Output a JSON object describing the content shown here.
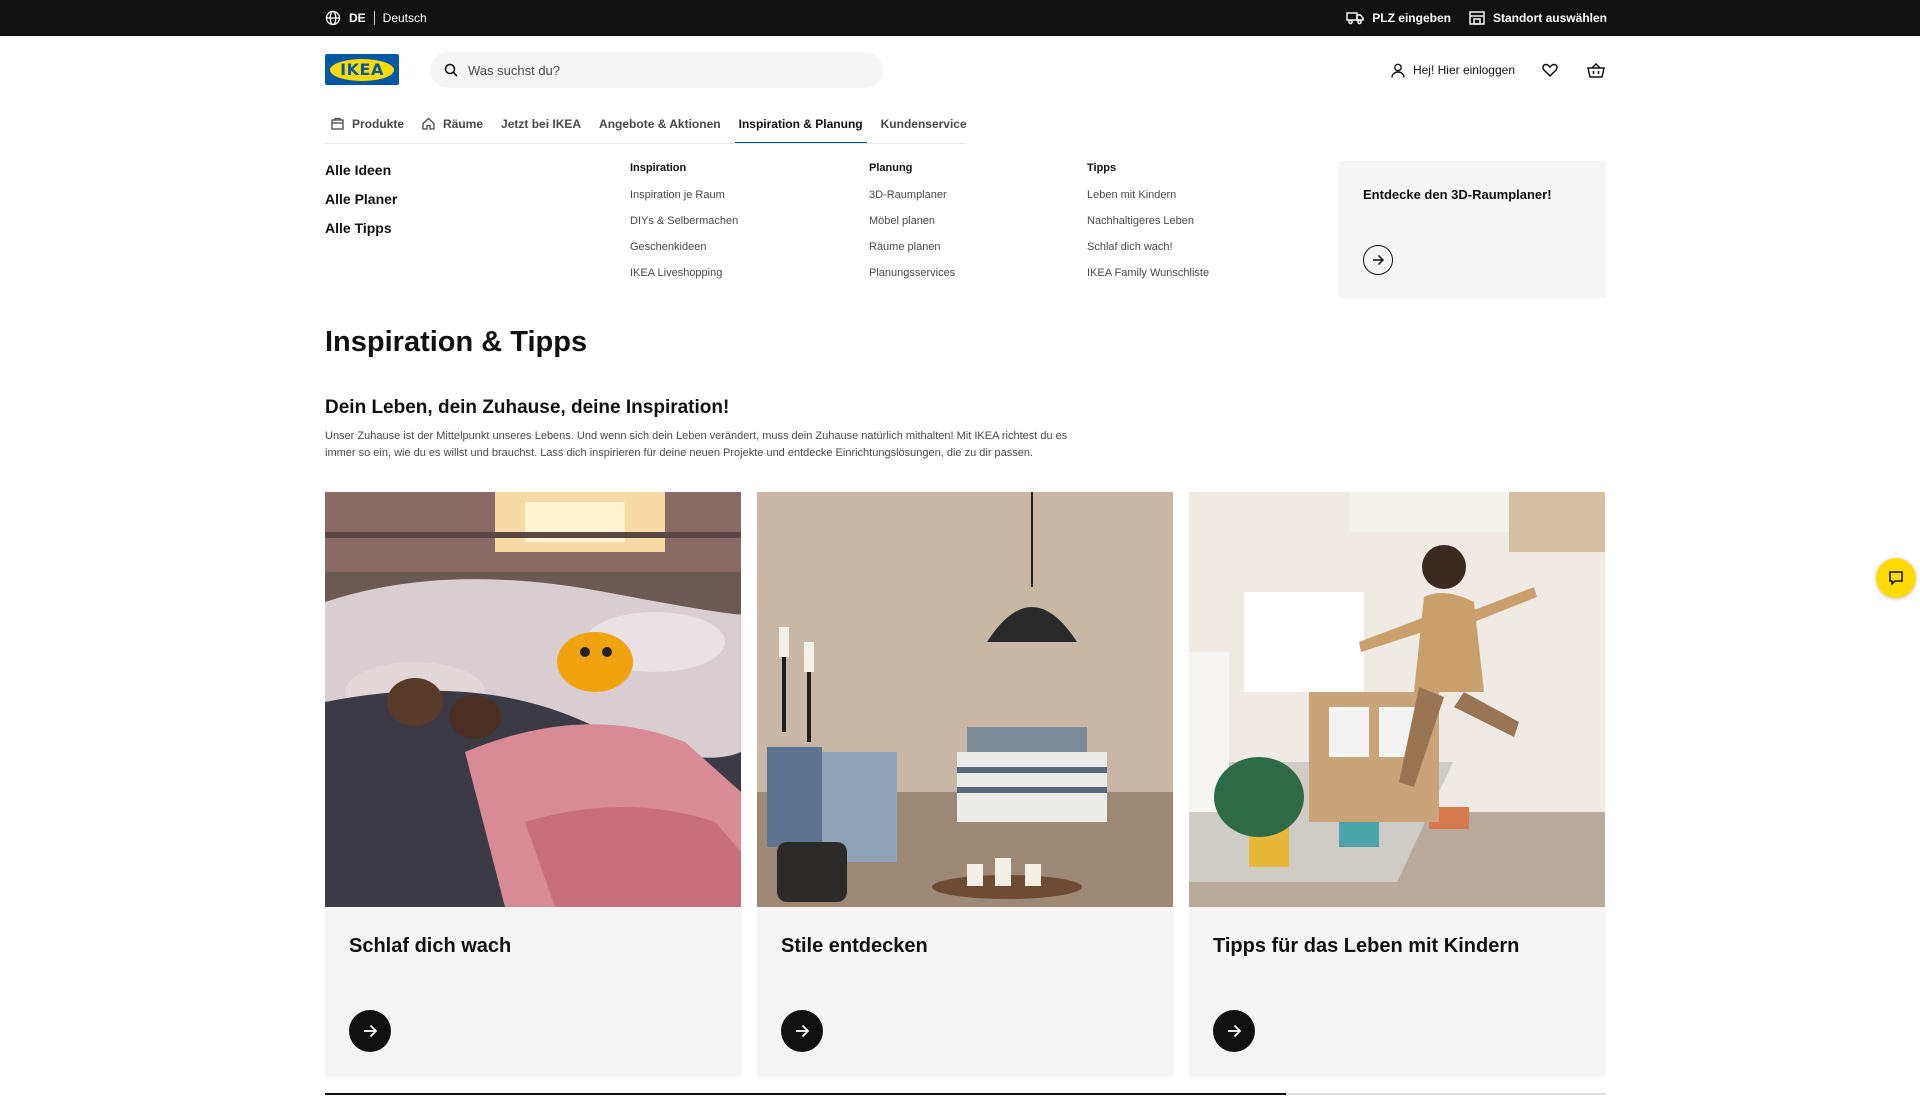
{
  "topbar": {
    "country": "DE",
    "language": "Deutsch",
    "zip_label": "PLZ eingeben",
    "store_label": "Standort auswählen"
  },
  "header": {
    "logo_text": "IKEA",
    "search_placeholder": "Was suchst du?",
    "login_label": "Hej! Hier einloggen"
  },
  "nav": {
    "tabs": [
      {
        "label": "Produkte",
        "icon": "bag-icon"
      },
      {
        "label": "Räume",
        "icon": "house-icon"
      },
      {
        "label": "Jetzt bei IKEA"
      },
      {
        "label": "Angebote & Aktionen"
      },
      {
        "label": "Inspiration & Planung",
        "active": true
      },
      {
        "label": "Kundenservice"
      }
    ]
  },
  "megamenu": {
    "main_links": [
      "Alle Ideen",
      "Alle Planer",
      "Alle Tipps"
    ],
    "columns": [
      {
        "heading": "Inspiration",
        "links": [
          "Inspiration je Raum",
          "DIYs & Selbermachen",
          "Geschenkideen",
          "IKEA Liveshopping"
        ]
      },
      {
        "heading": "Planung",
        "links": [
          "3D-Raumplaner",
          "Möbel planen",
          "Räume planen",
          "Planungsservices"
        ]
      },
      {
        "heading": "Tipps",
        "links": [
          "Leben mit Kindern",
          "Nachhaltigeres Leben",
          "Schlaf dich wach!",
          "IKEA Family Wunschliste"
        ]
      }
    ],
    "promo_title": "Entdecke den 3D-Raumplaner!"
  },
  "content": {
    "title": "Inspiration & Tipps",
    "subtitle": "Dein Leben, dein Zuhause, deine Inspiration!",
    "intro": "Unser Zuhause ist der Mittelpunkt unseres Lebens. Und wenn sich dein Leben verändert, muss dein Zuhause natürlich mithalten! Mit IKEA richtest du es immer so ein, wie du es willst und brauchst. Lass dich inspirieren für deine neuen Projekte und entdecke Einrichtungslösungen, die zu dir passen.",
    "cards": [
      {
        "title": "Schlaf dich wach"
      },
      {
        "title": "Stile entdecken"
      },
      {
        "title": "Tipps für das Leben mit Kindern"
      }
    ]
  },
  "colors": {
    "brand_blue": "#0058a3",
    "brand_yellow": "#ffdb00",
    "topbar": "#111111",
    "card_bg": "#f5f5f5"
  },
  "carousel_scroll_fraction": 0.75
}
